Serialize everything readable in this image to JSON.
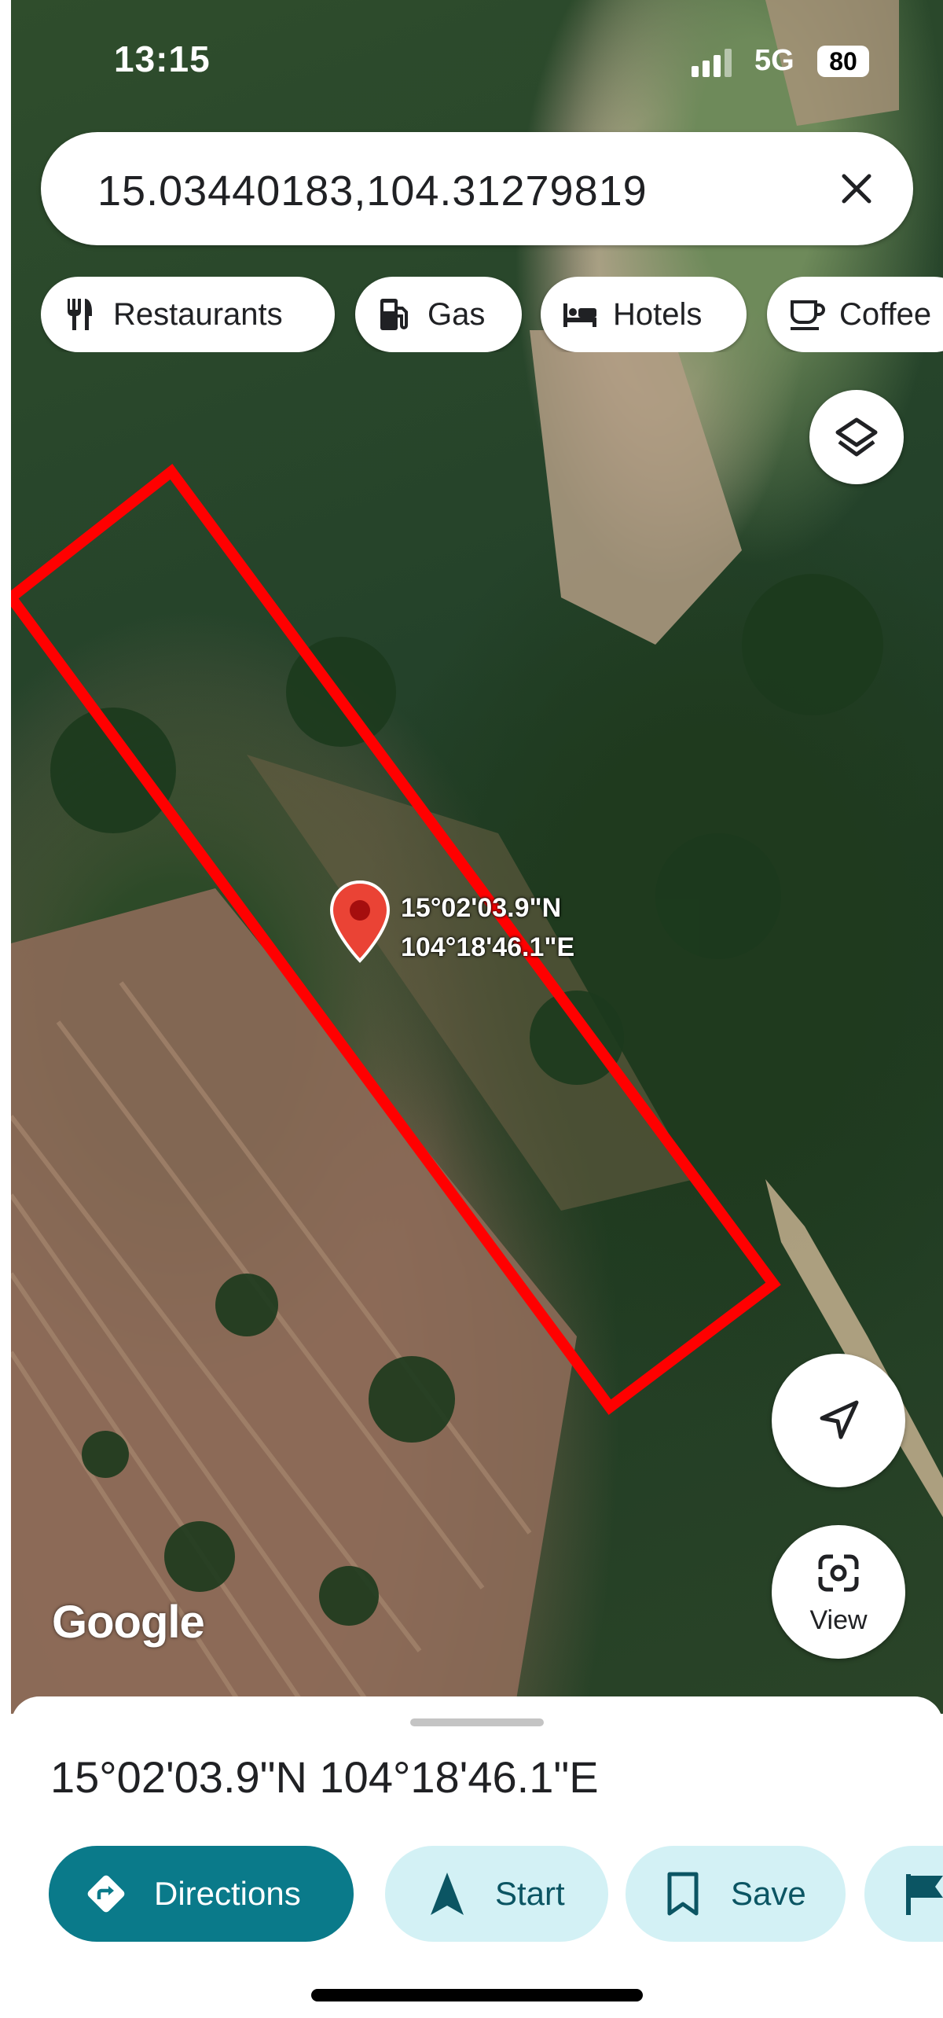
{
  "status_bar": {
    "time": "13:15",
    "network": "5G",
    "battery": "80"
  },
  "search": {
    "query": "15.03440183,104.31279819"
  },
  "chips": [
    {
      "label": "Restaurants",
      "icon": "fork-knife-icon"
    },
    {
      "label": "Gas",
      "icon": "gas-pump-icon"
    },
    {
      "label": "Hotels",
      "icon": "bed-icon"
    },
    {
      "label": "Coffee",
      "icon": "coffee-cup-icon"
    }
  ],
  "map": {
    "type": "satellite",
    "pin": {
      "lat_label": "15°02'03.9\"N",
      "lng_label": "104°18'46.1\"E",
      "color": "#ea4335"
    },
    "annotation_color": "#ff0000",
    "watermark": "Google"
  },
  "controls": {
    "view_label": "View"
  },
  "place": {
    "title": "15°02'03.9\"N 104°18'46.1\"E",
    "actions": [
      {
        "label": "Directions",
        "icon": "directions-icon"
      },
      {
        "label": "Start",
        "icon": "navigation-arrow-icon"
      },
      {
        "label": "Save",
        "icon": "bookmark-icon"
      },
      {
        "label": "",
        "icon": "flag-icon"
      }
    ],
    "accent": "#0a7a8a",
    "secondary_bg": "#d3f1f5"
  }
}
